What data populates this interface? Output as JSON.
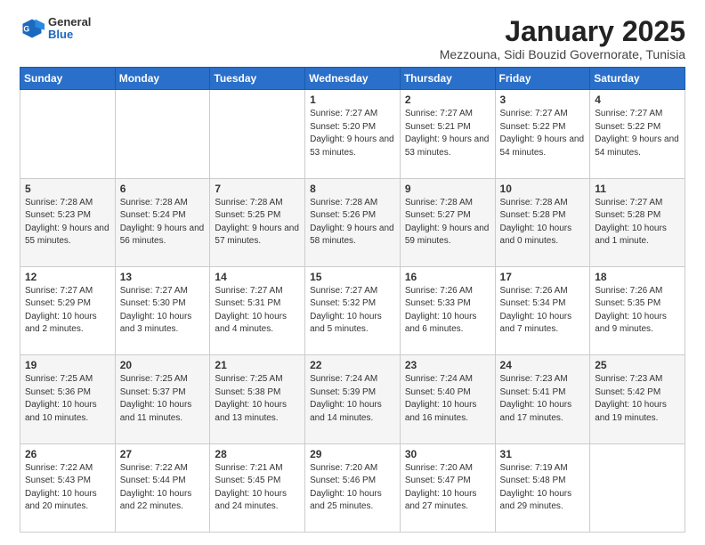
{
  "header": {
    "logo_general": "General",
    "logo_blue": "Blue",
    "title": "January 2025",
    "subtitle": "Mezzouna, Sidi Bouzid Governorate, Tunisia"
  },
  "days_of_week": [
    "Sunday",
    "Monday",
    "Tuesday",
    "Wednesday",
    "Thursday",
    "Friday",
    "Saturday"
  ],
  "weeks": [
    [
      {
        "day": "",
        "info": ""
      },
      {
        "day": "",
        "info": ""
      },
      {
        "day": "",
        "info": ""
      },
      {
        "day": "1",
        "info": "Sunrise: 7:27 AM\nSunset: 5:20 PM\nDaylight: 9 hours\nand 53 minutes."
      },
      {
        "day": "2",
        "info": "Sunrise: 7:27 AM\nSunset: 5:21 PM\nDaylight: 9 hours\nand 53 minutes."
      },
      {
        "day": "3",
        "info": "Sunrise: 7:27 AM\nSunset: 5:22 PM\nDaylight: 9 hours\nand 54 minutes."
      },
      {
        "day": "4",
        "info": "Sunrise: 7:27 AM\nSunset: 5:22 PM\nDaylight: 9 hours\nand 54 minutes."
      }
    ],
    [
      {
        "day": "5",
        "info": "Sunrise: 7:28 AM\nSunset: 5:23 PM\nDaylight: 9 hours\nand 55 minutes."
      },
      {
        "day": "6",
        "info": "Sunrise: 7:28 AM\nSunset: 5:24 PM\nDaylight: 9 hours\nand 56 minutes."
      },
      {
        "day": "7",
        "info": "Sunrise: 7:28 AM\nSunset: 5:25 PM\nDaylight: 9 hours\nand 57 minutes."
      },
      {
        "day": "8",
        "info": "Sunrise: 7:28 AM\nSunset: 5:26 PM\nDaylight: 9 hours\nand 58 minutes."
      },
      {
        "day": "9",
        "info": "Sunrise: 7:28 AM\nSunset: 5:27 PM\nDaylight: 9 hours\nand 59 minutes."
      },
      {
        "day": "10",
        "info": "Sunrise: 7:28 AM\nSunset: 5:28 PM\nDaylight: 10 hours\nand 0 minutes."
      },
      {
        "day": "11",
        "info": "Sunrise: 7:27 AM\nSunset: 5:28 PM\nDaylight: 10 hours\nand 1 minute."
      }
    ],
    [
      {
        "day": "12",
        "info": "Sunrise: 7:27 AM\nSunset: 5:29 PM\nDaylight: 10 hours\nand 2 minutes."
      },
      {
        "day": "13",
        "info": "Sunrise: 7:27 AM\nSunset: 5:30 PM\nDaylight: 10 hours\nand 3 minutes."
      },
      {
        "day": "14",
        "info": "Sunrise: 7:27 AM\nSunset: 5:31 PM\nDaylight: 10 hours\nand 4 minutes."
      },
      {
        "day": "15",
        "info": "Sunrise: 7:27 AM\nSunset: 5:32 PM\nDaylight: 10 hours\nand 5 minutes."
      },
      {
        "day": "16",
        "info": "Sunrise: 7:26 AM\nSunset: 5:33 PM\nDaylight: 10 hours\nand 6 minutes."
      },
      {
        "day": "17",
        "info": "Sunrise: 7:26 AM\nSunset: 5:34 PM\nDaylight: 10 hours\nand 7 minutes."
      },
      {
        "day": "18",
        "info": "Sunrise: 7:26 AM\nSunset: 5:35 PM\nDaylight: 10 hours\nand 9 minutes."
      }
    ],
    [
      {
        "day": "19",
        "info": "Sunrise: 7:25 AM\nSunset: 5:36 PM\nDaylight: 10 hours\nand 10 minutes."
      },
      {
        "day": "20",
        "info": "Sunrise: 7:25 AM\nSunset: 5:37 PM\nDaylight: 10 hours\nand 11 minutes."
      },
      {
        "day": "21",
        "info": "Sunrise: 7:25 AM\nSunset: 5:38 PM\nDaylight: 10 hours\nand 13 minutes."
      },
      {
        "day": "22",
        "info": "Sunrise: 7:24 AM\nSunset: 5:39 PM\nDaylight: 10 hours\nand 14 minutes."
      },
      {
        "day": "23",
        "info": "Sunrise: 7:24 AM\nSunset: 5:40 PM\nDaylight: 10 hours\nand 16 minutes."
      },
      {
        "day": "24",
        "info": "Sunrise: 7:23 AM\nSunset: 5:41 PM\nDaylight: 10 hours\nand 17 minutes."
      },
      {
        "day": "25",
        "info": "Sunrise: 7:23 AM\nSunset: 5:42 PM\nDaylight: 10 hours\nand 19 minutes."
      }
    ],
    [
      {
        "day": "26",
        "info": "Sunrise: 7:22 AM\nSunset: 5:43 PM\nDaylight: 10 hours\nand 20 minutes."
      },
      {
        "day": "27",
        "info": "Sunrise: 7:22 AM\nSunset: 5:44 PM\nDaylight: 10 hours\nand 22 minutes."
      },
      {
        "day": "28",
        "info": "Sunrise: 7:21 AM\nSunset: 5:45 PM\nDaylight: 10 hours\nand 24 minutes."
      },
      {
        "day": "29",
        "info": "Sunrise: 7:20 AM\nSunset: 5:46 PM\nDaylight: 10 hours\nand 25 minutes."
      },
      {
        "day": "30",
        "info": "Sunrise: 7:20 AM\nSunset: 5:47 PM\nDaylight: 10 hours\nand 27 minutes."
      },
      {
        "day": "31",
        "info": "Sunrise: 7:19 AM\nSunset: 5:48 PM\nDaylight: 10 hours\nand 29 minutes."
      },
      {
        "day": "",
        "info": ""
      }
    ]
  ]
}
